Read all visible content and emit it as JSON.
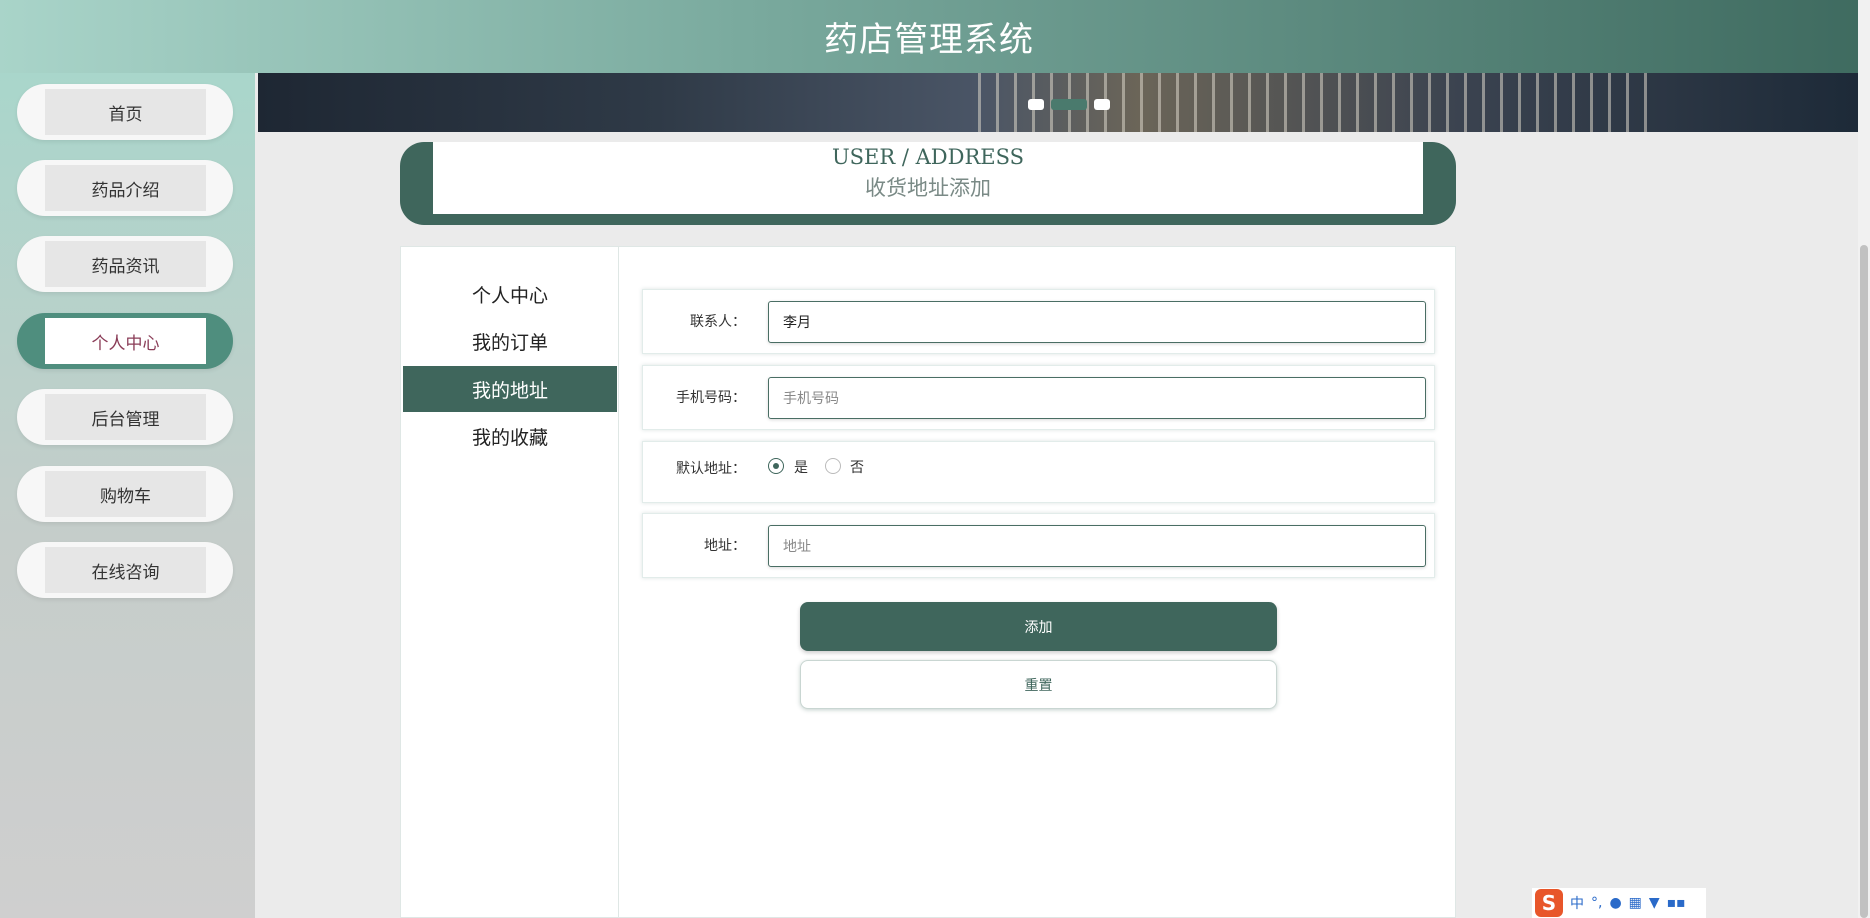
{
  "app": {
    "title": "药店管理系统"
  },
  "sidebar": {
    "items": [
      {
        "label": "首页",
        "active": false
      },
      {
        "label": "药品介绍",
        "active": false
      },
      {
        "label": "药品资讯",
        "active": false
      },
      {
        "label": "个人中心",
        "active": true
      },
      {
        "label": "后台管理",
        "active": false
      },
      {
        "label": "购物车",
        "active": false
      },
      {
        "label": "在线咨询",
        "active": false
      }
    ]
  },
  "banner": {
    "slide_count": 3,
    "active_slide": 2
  },
  "page_heading": {
    "en": "USER / ADDRESS",
    "cn": "收货地址添加"
  },
  "subnav": {
    "items": [
      {
        "label": "个人中心",
        "active": false
      },
      {
        "label": "我的订单",
        "active": false
      },
      {
        "label": "我的地址",
        "active": true
      },
      {
        "label": "我的收藏",
        "active": false
      }
    ]
  },
  "form": {
    "contact_label": "联系人：",
    "contact_value": "李月",
    "phone_label": "手机号码：",
    "phone_placeholder": "手机号码",
    "default_label": "默认地址：",
    "default_yes": "是",
    "default_no": "否",
    "default_selected": "是",
    "address_label": "地址：",
    "address_placeholder": "地址",
    "submit_label": "添加",
    "reset_label": "重置"
  },
  "ime": {
    "logo": "S",
    "lang": "中",
    "punct": "°,",
    "icons": [
      "mic-icon",
      "keyboard-icon",
      "skin-icon",
      "toolbox-icon"
    ]
  },
  "colors": {
    "primary": "#3f665c",
    "accent_active_text": "#8a3c57",
    "sidebar_active": "#4f8e7e"
  }
}
